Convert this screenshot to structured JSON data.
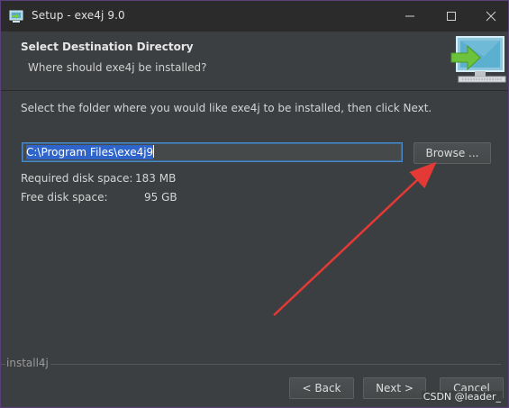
{
  "titlebar": {
    "title": "Setup - exe4j 9.0",
    "minimize_icon": "minimize-icon",
    "maximize_icon": "maximize-icon",
    "close_icon": "close-icon"
  },
  "header": {
    "title": "Select Destination Directory",
    "subtitle": "Where should exe4j be installed?",
    "graphic_icon": "computer-install-icon"
  },
  "main": {
    "instruction": "Select the folder where you would like exe4j to be installed, then click Next.",
    "path_value": "C:\\Program Files\\exe4j9",
    "browse_label": "Browse ...",
    "required_space_label": "Required disk space:",
    "required_space_value": "183 MB",
    "free_space_label": "Free disk space:",
    "free_space_value": "95 GB"
  },
  "footer": {
    "brand": "install4j",
    "back_label": "< Back",
    "next_label": "Next >",
    "cancel_label": "Cancel"
  },
  "watermark": "CSDN @leader_",
  "colors": {
    "background": "#3c3f41",
    "titlebar": "#2b2b2b",
    "selection": "#2f65ca",
    "focus_border": "#4a88c7",
    "annotation_arrow": "#e53935"
  }
}
